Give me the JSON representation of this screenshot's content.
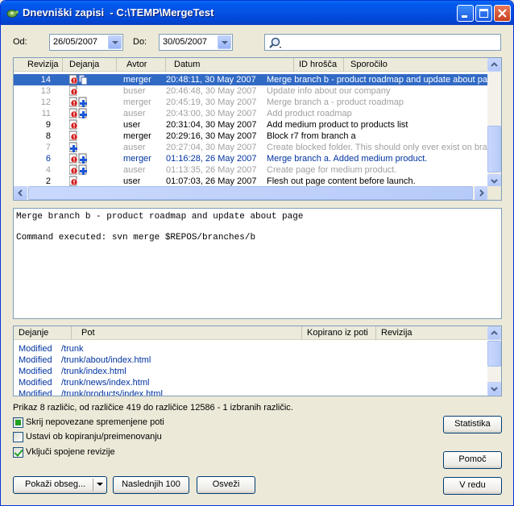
{
  "window": {
    "title": "Dnevniški zapisi  - C:\\TEMP\\MergeTest"
  },
  "filters": {
    "from_label": "Od:",
    "from_value": "26/05/2007",
    "to_label": "Do:",
    "to_value": "30/05/2007",
    "search_value": ""
  },
  "log": {
    "columns": [
      "Revizija",
      "Dejanja",
      "Avtor",
      "Datum",
      "ID hrošča",
      "Sporočilo"
    ],
    "rows": [
      {
        "rev": "14",
        "author": "merger",
        "date": "20:48:11, 30 May 2007",
        "message": "Merge branch b - product roadmap and update about page",
        "style": "selected",
        "actions": [
          "mod",
          "copy"
        ]
      },
      {
        "rev": "13",
        "author": "buser",
        "date": "20:46:48, 30 May 2007",
        "message": "Update info about our company",
        "style": "grey",
        "actions": [
          "mod"
        ]
      },
      {
        "rev": "12",
        "author": "merger",
        "date": "20:45:19, 30 May 2007",
        "message": "Merge branch a - product roadmap",
        "style": "grey",
        "actions": [
          "mod",
          "add"
        ]
      },
      {
        "rev": "11",
        "author": "auser",
        "date": "20:43:00, 30 May 2007",
        "message": "Add product roadmap",
        "style": "grey",
        "actions": [
          "mod",
          "add"
        ]
      },
      {
        "rev": "9",
        "author": "user",
        "date": "20:31:04, 30 May 2007",
        "message": "Add medium product to products list",
        "style": "normal",
        "actions": [
          "mod"
        ]
      },
      {
        "rev": "8",
        "author": "merger",
        "date": "20:29:16, 30 May 2007",
        "message": "Block r7 from branch a",
        "style": "normal",
        "actions": [
          "mod"
        ]
      },
      {
        "rev": "7",
        "author": "auser",
        "date": "20:27:04, 30 May 2007",
        "message": "Create blocked folder.  This should only ever exist on bra",
        "style": "grey",
        "actions": [
          "add"
        ]
      },
      {
        "rev": "6",
        "author": "merger",
        "date": "01:16:28, 26 May 2007",
        "message": "Merge branch a.  Added medium product.",
        "style": "blue",
        "actions": [
          "mod",
          "add"
        ]
      },
      {
        "rev": "4",
        "author": "auser",
        "date": "01:13:35, 26 May 2007",
        "message": "Create page for medium product.",
        "style": "grey",
        "actions": [
          "mod",
          "add"
        ]
      },
      {
        "rev": "2",
        "author": "user",
        "date": "01:07:03, 26 May 2007",
        "message": "Flesh out page content before launch.",
        "style": "normal",
        "actions": [
          "mod"
        ]
      }
    ]
  },
  "message_box": {
    "line1": "Merge branch b - product roadmap and update about page",
    "line2": "",
    "line3": "Command executed: svn merge $REPOS/branches/b"
  },
  "paths": {
    "columns": [
      "Dejanje",
      "Pot",
      "Kopirano iz poti",
      "Revizija"
    ],
    "rows": [
      {
        "action": "Modified",
        "path": "/trunk"
      },
      {
        "action": "Modified",
        "path": "/trunk/about/index.html"
      },
      {
        "action": "Modified",
        "path": "/trunk/index.html"
      },
      {
        "action": "Modified",
        "path": "/trunk/news/index.html"
      },
      {
        "action": "Modified",
        "path": "/trunk/products/index.html"
      }
    ]
  },
  "status": "Prikaz 8 različic, od različice 419 do različice 12586 - 1 izbranih različic.",
  "options": {
    "hide_unrelated": "Skrij nepovezane spremenjene poti",
    "stop_on_copy": "Ustavi ob kopiranju/preimenovanju",
    "include_merged": "Vključi spojene revizije"
  },
  "buttons": {
    "show_range": "Pokaži obseg...",
    "next_100": "Naslednjih 100",
    "refresh": "Osveži",
    "statistics": "Statistika",
    "help": "Pomoč",
    "ok": "V redu"
  },
  "colors": {
    "titlebar": "#0054e3",
    "selection": "#316ac5",
    "merged_text": "#0033a0",
    "disabled_text": "#a0a0a0"
  }
}
